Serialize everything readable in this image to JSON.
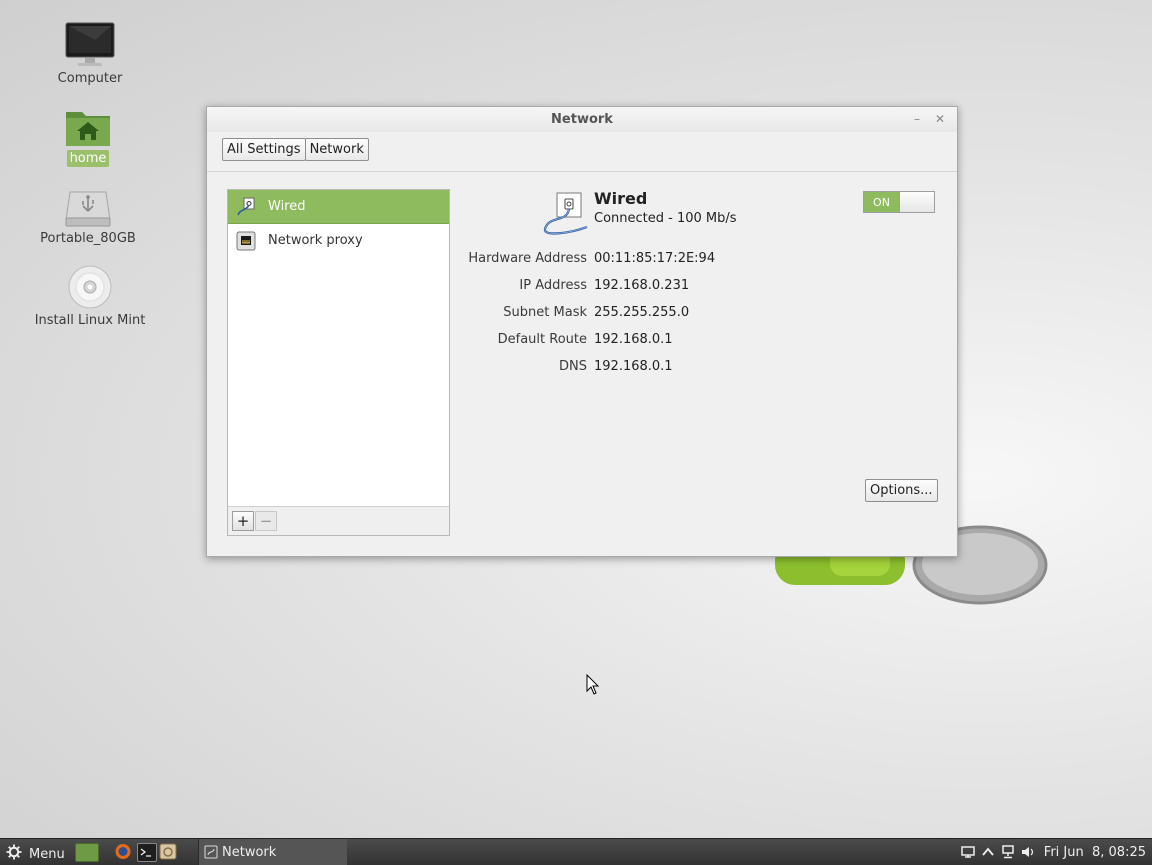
{
  "desktop": {
    "icons": [
      {
        "label": "Computer",
        "icon": "monitor-icon"
      },
      {
        "label": "home",
        "icon": "home-folder-icon",
        "selected": true
      },
      {
        "label": "Portable_80GB",
        "icon": "usb-drive-icon"
      },
      {
        "label": "Install Linux Mint",
        "icon": "cdrom-icon"
      }
    ]
  },
  "window": {
    "title": "Network",
    "breadcrumbs": [
      "All Settings",
      "Network"
    ],
    "sidebar": {
      "items": [
        {
          "label": "Wired",
          "icon": "wired-network-icon",
          "selected": true
        },
        {
          "label": "Network proxy",
          "icon": "network-proxy-icon"
        }
      ],
      "add_label": "+",
      "remove_label": "−"
    },
    "detail": {
      "name": "Wired",
      "status": "Connected - 100 Mb/s",
      "switch_label": "ON",
      "switch_on": true,
      "properties": [
        {
          "label": "Hardware Address",
          "value": "00:11:85:17:2E:94"
        },
        {
          "label": "IP Address",
          "value": "192.168.0.231"
        },
        {
          "label": "Subnet Mask",
          "value": "255.255.255.0"
        },
        {
          "label": "Default Route",
          "value": "192.168.0.1"
        },
        {
          "label": "DNS",
          "value": "192.168.0.1"
        }
      ],
      "options_label": "Options..."
    }
  },
  "taskbar": {
    "menu_label": "Menu",
    "launchers": [
      "show-desktop-icon",
      "firefox-icon",
      "terminal-icon",
      "files-icon"
    ],
    "window_button_label": "Network",
    "tray_icons": [
      "display-icon",
      "chevron-up-icon",
      "network-icon",
      "volume-icon"
    ],
    "clock": "Fri Jun  8, 08:25"
  },
  "colors": {
    "accent": "#8fbb5f",
    "taskbar": "#3c3c3c"
  }
}
